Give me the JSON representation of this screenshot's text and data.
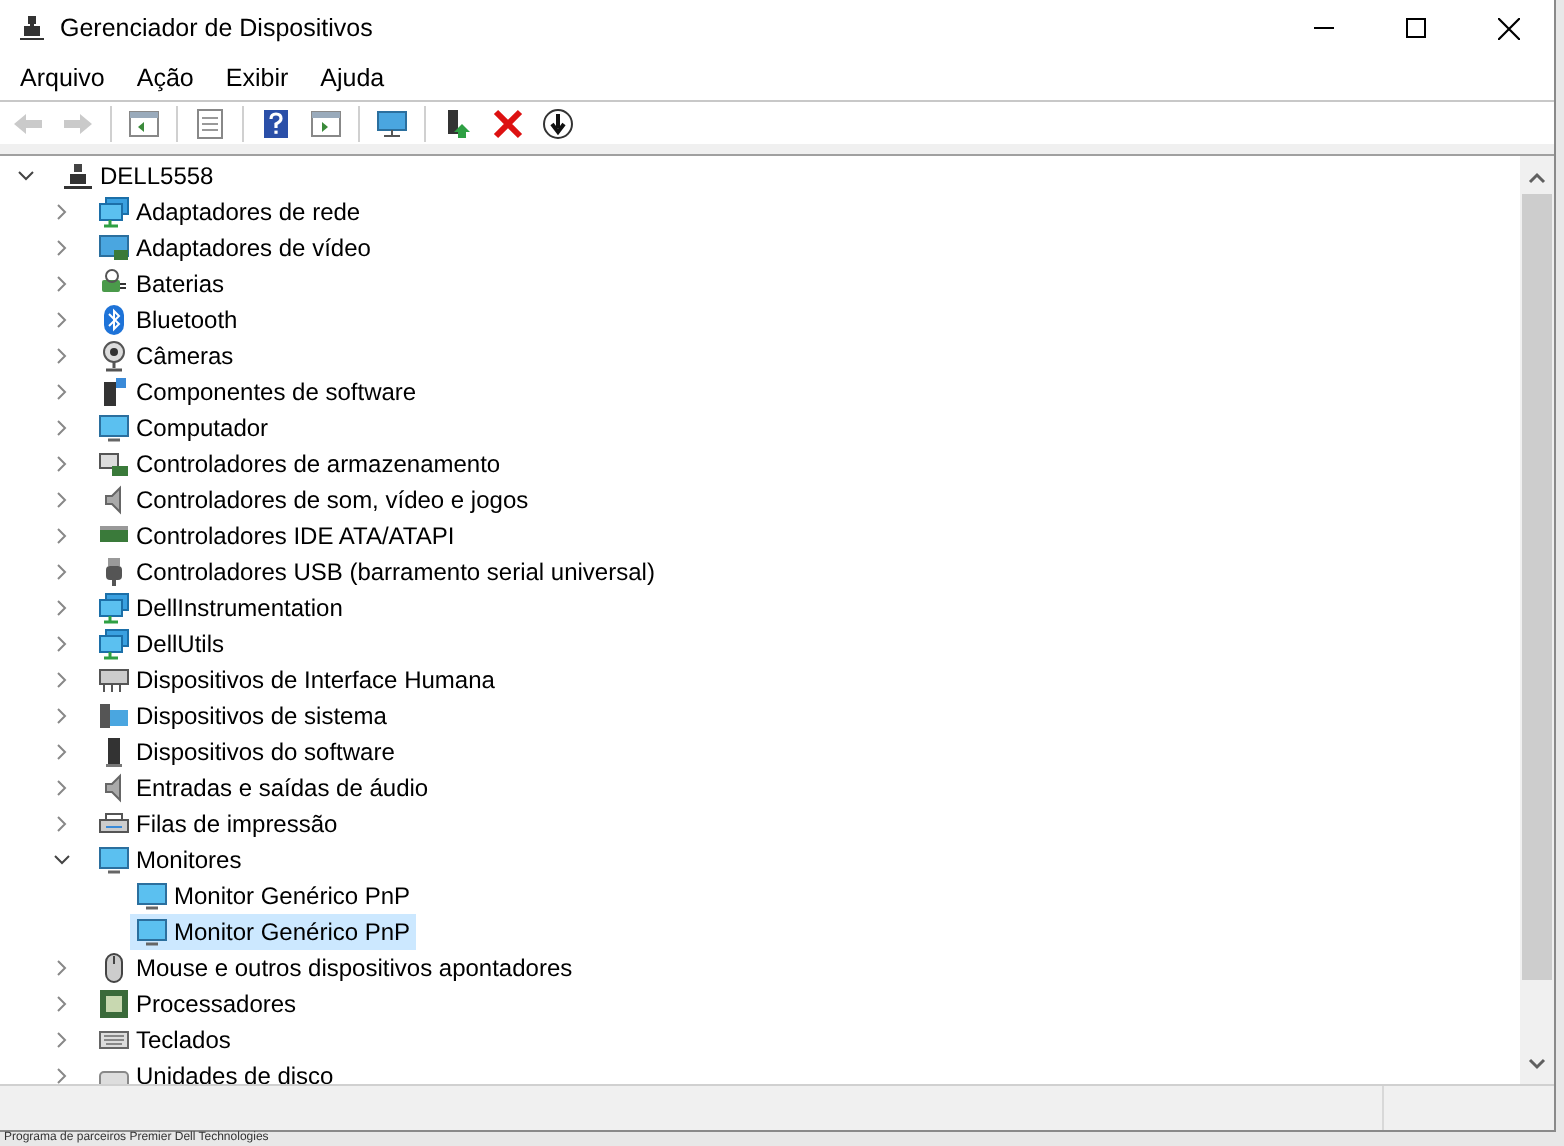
{
  "window": {
    "title": "Gerenciador de Dispositivos"
  },
  "menu": [
    "Arquivo",
    "Ação",
    "Exibir",
    "Ajuda"
  ],
  "toolbar": [
    {
      "kind": "back",
      "disabled": true
    },
    {
      "kind": "forward",
      "disabled": true
    },
    {
      "kind": "sep"
    },
    {
      "kind": "console-tree"
    },
    {
      "kind": "sep"
    },
    {
      "kind": "properties"
    },
    {
      "kind": "sep"
    },
    {
      "kind": "help"
    },
    {
      "kind": "action-pane"
    },
    {
      "kind": "sep"
    },
    {
      "kind": "scan"
    },
    {
      "kind": "sep"
    },
    {
      "kind": "update-driver"
    },
    {
      "kind": "uninstall"
    },
    {
      "kind": "disable-device"
    }
  ],
  "tree": {
    "label": "DELL5558",
    "kind": "computer",
    "expanded": true,
    "selected": false,
    "children": [
      {
        "label": "Adaptadores de rede",
        "kind": "network",
        "expanded": false,
        "selected": false
      },
      {
        "label": "Adaptadores de vídeo",
        "kind": "video",
        "expanded": false,
        "selected": false
      },
      {
        "label": "Baterias",
        "kind": "battery",
        "expanded": false,
        "selected": false
      },
      {
        "label": "Bluetooth",
        "kind": "bluetooth",
        "expanded": false,
        "selected": false
      },
      {
        "label": "Câmeras",
        "kind": "camera",
        "expanded": false,
        "selected": false
      },
      {
        "label": "Componentes de software",
        "kind": "component",
        "expanded": false,
        "selected": false
      },
      {
        "label": "Computador",
        "kind": "monitor",
        "expanded": false,
        "selected": false
      },
      {
        "label": "Controladores de armazenamento",
        "kind": "storage",
        "expanded": false,
        "selected": false
      },
      {
        "label": "Controladores de som, vídeo e jogos",
        "kind": "sound",
        "expanded": false,
        "selected": false
      },
      {
        "label": "Controladores IDE ATA/ATAPI",
        "kind": "card",
        "expanded": false,
        "selected": false
      },
      {
        "label": "Controladores USB (barramento serial universal)",
        "kind": "usb",
        "expanded": false,
        "selected": false
      },
      {
        "label": "DellInstrumentation",
        "kind": "network",
        "expanded": false,
        "selected": false
      },
      {
        "label": "DellUtils",
        "kind": "network",
        "expanded": false,
        "selected": false
      },
      {
        "label": "Dispositivos de Interface Humana",
        "kind": "hid",
        "expanded": false,
        "selected": false
      },
      {
        "label": "Dispositivos de sistema",
        "kind": "system",
        "expanded": false,
        "selected": false
      },
      {
        "label": "Dispositivos do software",
        "kind": "tower",
        "expanded": false,
        "selected": false
      },
      {
        "label": "Entradas e saídas de áudio",
        "kind": "sound",
        "expanded": false,
        "selected": false
      },
      {
        "label": "Filas de impressão",
        "kind": "printer",
        "expanded": false,
        "selected": false
      },
      {
        "label": "Monitores",
        "kind": "monitor",
        "expanded": true,
        "selected": false,
        "children": [
          {
            "label": "Monitor Genérico PnP",
            "kind": "monitor",
            "selected": false
          },
          {
            "label": "Monitor Genérico PnP",
            "kind": "monitor",
            "selected": true
          }
        ]
      },
      {
        "label": "Mouse e outros dispositivos apontadores",
        "kind": "mouse",
        "expanded": false,
        "selected": false
      },
      {
        "label": "Processadores",
        "kind": "cpu",
        "expanded": false,
        "selected": false
      },
      {
        "label": "Teclados",
        "kind": "keyboard",
        "expanded": false,
        "selected": false
      },
      {
        "label": "Unidades de disco",
        "kind": "disk",
        "expanded": false,
        "selected": false
      }
    ]
  },
  "background_page": {
    "text": "Programa de parceiros   Premier   Dell Technologies"
  }
}
